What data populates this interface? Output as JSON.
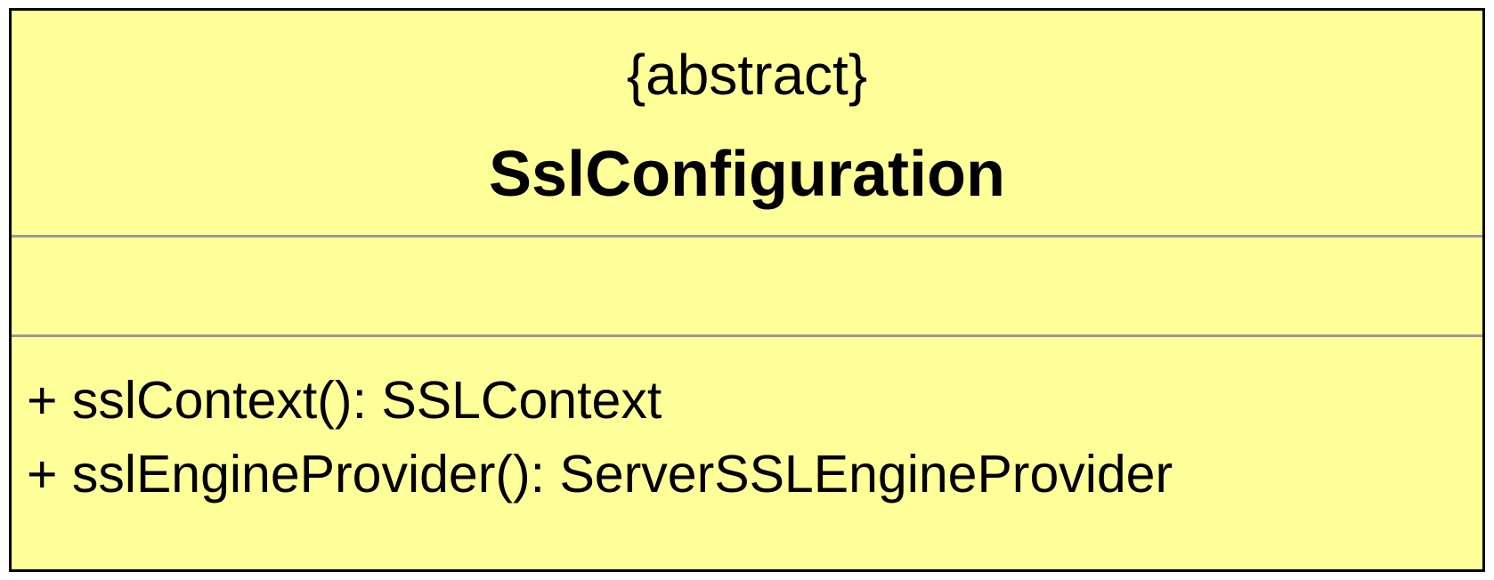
{
  "class": {
    "stereotype": "{abstract}",
    "name": "SslConfiguration",
    "attributes": [],
    "operations": [
      "+ sslContext(): SSLContext",
      "+ sslEngineProvider(): ServerSSLEngineProvider"
    ]
  },
  "colors": {
    "fill": "#ffff99",
    "border": "#000000",
    "divider": "#999999"
  }
}
